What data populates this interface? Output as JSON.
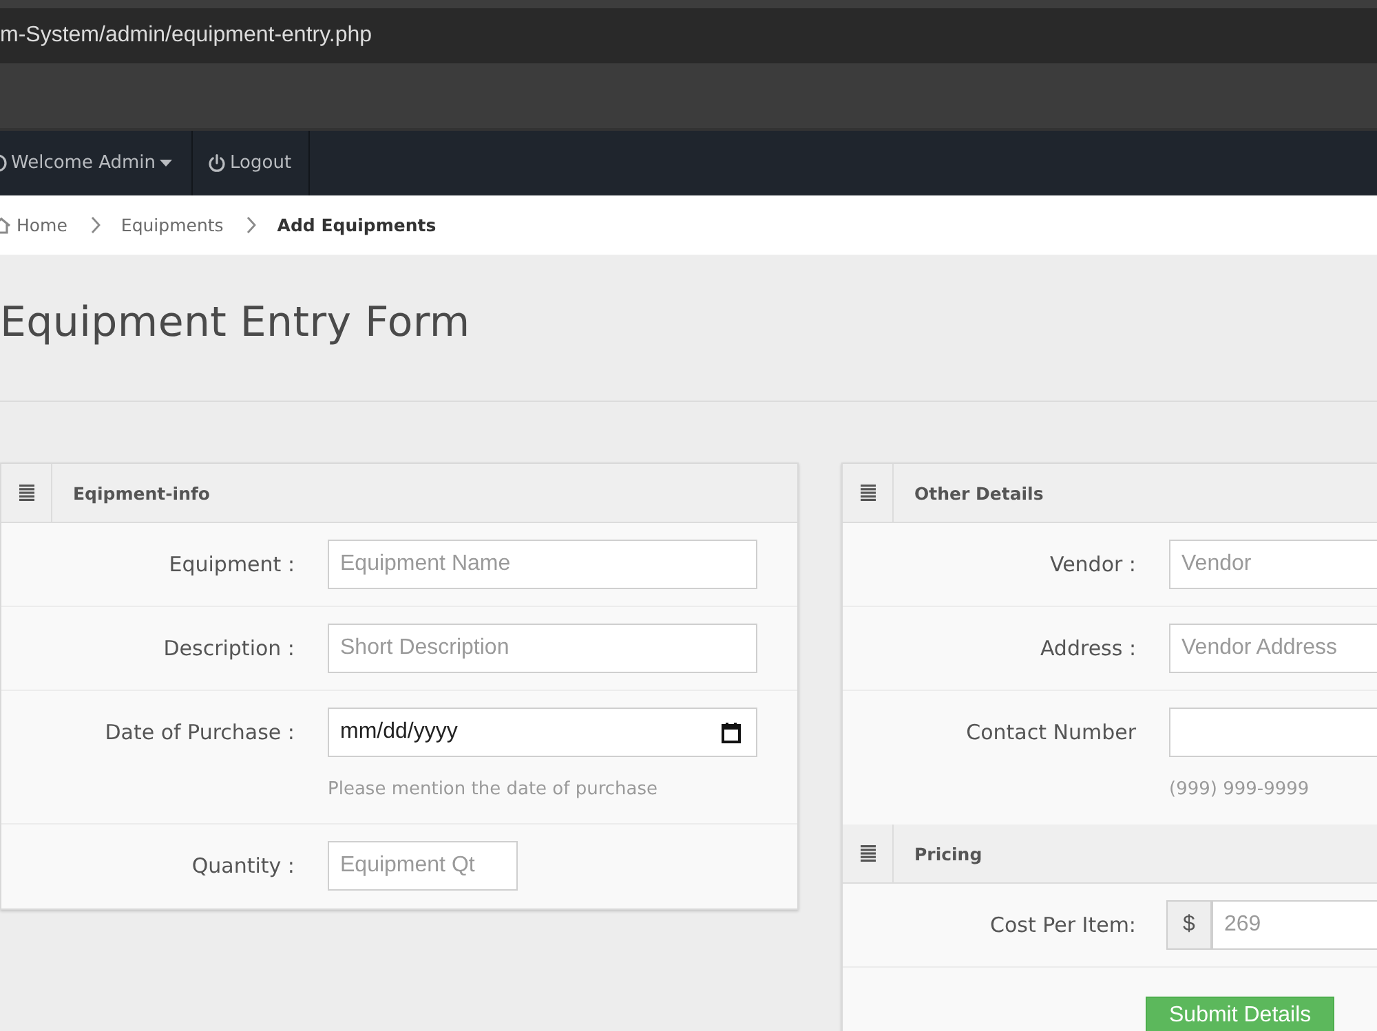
{
  "browser": {
    "address": "m-System/admin/equipment-entry.php"
  },
  "navbar": {
    "items": [
      {
        "kind": "user-menu",
        "label": "Welcome Admin"
      },
      {
        "kind": "logout",
        "label": "Logout"
      }
    ]
  },
  "breadcrumb": [
    {
      "label": "Home",
      "current": false
    },
    {
      "label": "Equipments",
      "current": false
    },
    {
      "label": "Add Equipments",
      "current": true
    }
  ],
  "page_title": "Equipment Entry Form",
  "columns": [
    {
      "sections": [
        {
          "title": "Eqipment-info",
          "fields": [
            {
              "kind": "text",
              "label": "Equipment :",
              "placeholder": "Equipment Name"
            },
            {
              "kind": "text",
              "label": "Description :",
              "placeholder": "Short Description"
            },
            {
              "kind": "date",
              "label": "Date of Purchase :",
              "value": "mm/dd/yyyy",
              "help": "Please mention the date of purchase"
            },
            {
              "kind": "number",
              "label": "Quantity :",
              "placeholder": "Equipment Qt"
            }
          ]
        }
      ]
    },
    {
      "sections": [
        {
          "title": "Other Details",
          "fields": [
            {
              "kind": "text",
              "label": "Vendor :",
              "placeholder": "Vendor"
            },
            {
              "kind": "text",
              "label": "Address :",
              "placeholder": "Vendor Address"
            },
            {
              "kind": "text",
              "label": "Contact Number",
              "help": "(999) 999-9999"
            }
          ]
        },
        {
          "title": "Pricing",
          "fields": [
            {
              "kind": "currency",
              "label": "Cost Per Item:",
              "addon": "$",
              "placeholder": "269"
            }
          ]
        }
      ],
      "submit": "Submit Details"
    }
  ]
}
